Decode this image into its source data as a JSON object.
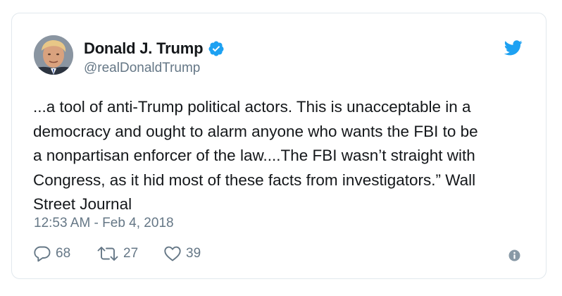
{
  "tweet": {
    "display_name": "Donald J. Trump",
    "handle": "@realDonaldTrump",
    "text": "...a tool of anti-Trump political actors. This is unacceptable in a\ndemocracy and ought to alarm anyone who wants the FBI to be\na nonpartisan enforcer of the law....The FBI wasn’t straight with\nCongress, as it hid most of these facts from investigators.” Wall\nStreet Journal",
    "timestamp": "12:53 AM - Feb 4, 2018",
    "replies": "68",
    "retweets": "27",
    "likes": "39"
  },
  "icons": {
    "verified": "verified-badge-icon",
    "brand": "twitter-bird-icon",
    "reply": "reply-icon",
    "retweet": "retweet-icon",
    "like": "heart-icon",
    "info": "info-icon"
  },
  "colors": {
    "brand_blue": "#1da1f2",
    "text": "#14171a",
    "secondary": "#657786",
    "border": "#e1e8ed"
  }
}
